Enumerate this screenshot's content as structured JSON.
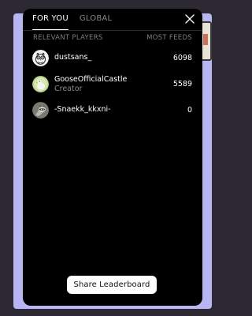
{
  "tabs": [
    {
      "label": "FOR YOU",
      "active": true
    },
    {
      "label": "GLOBAL",
      "active": false
    }
  ],
  "table": {
    "col_players": "RELEVANT PLAYERS",
    "col_feeds": "MOST FEEDS"
  },
  "players": [
    {
      "name": "dustsans_",
      "subtitle": "",
      "score": "6098",
      "avatar_icon": "owl-avatar-icon"
    },
    {
      "name": "GooseOfficialCastle",
      "subtitle": "Creator",
      "score": "5589",
      "avatar_icon": "goose-avatar-icon"
    },
    {
      "name": "-Snaekk_kkxni-",
      "subtitle": "",
      "score": "0",
      "avatar_icon": "raccoon-avatar-icon"
    }
  ],
  "share_button": "Share Leaderboard",
  "close_icon": "close-icon",
  "colors": {
    "modal_bg": "#000000",
    "backdrop": "#b7b6f2",
    "muted_text": "#8a8a8a",
    "button_bg": "#ffffff"
  }
}
